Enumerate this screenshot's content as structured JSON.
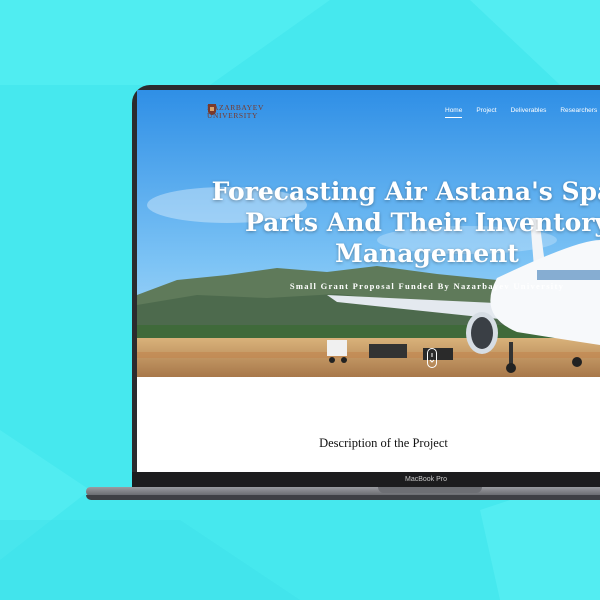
{
  "site": {
    "logo_lines": [
      "Nazarbayev",
      "University"
    ],
    "nav": [
      "Home",
      "Project",
      "Deliverables",
      "Researchers"
    ],
    "active_nav": "Home",
    "hero_title": "Forecasting Air Astana's Spare Parts And Their Inventory Management",
    "hero_subtitle": "Small Grant Proposal Funded By Nazarbayev University",
    "section_title": "Description of the Project"
  },
  "device": {
    "model_label": "MacBook Pro"
  },
  "colors": {
    "background": "#46e8ee",
    "logo": "#7a3a2c",
    "sky": "#3fa3ec"
  },
  "icons": [
    "university-crest-icon",
    "scroll-mouse-icon"
  ]
}
